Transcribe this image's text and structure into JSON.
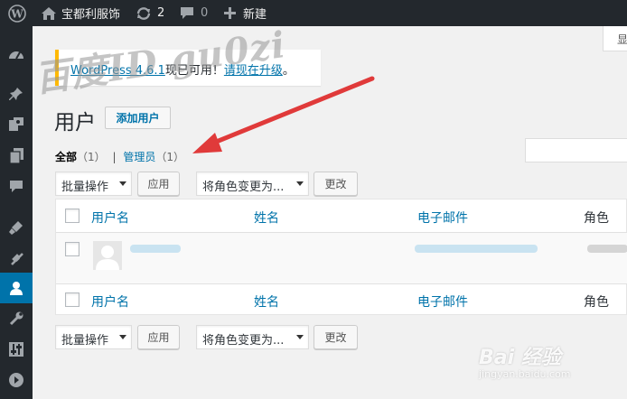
{
  "admin_bar": {
    "site_name": "宝都利服饰",
    "updates_count": "2",
    "comments_count": "0",
    "new_label": "新建"
  },
  "screen_options_label": "显",
  "notice": {
    "link_text": "WordPress 4.6.1",
    "middle_text": "现已可用！",
    "action_text": "请现在升级",
    "end_text": "。"
  },
  "page": {
    "title": "用户",
    "add_new_label": "添加用户"
  },
  "filters": {
    "all_label": "全部",
    "all_count": "（1）",
    "separator": "|",
    "admin_label": "管理员",
    "admin_count": "（1）"
  },
  "bulk_actions": {
    "select_label": "批量操作",
    "apply_label": "应用",
    "role_select_label": "将角色变更为...",
    "change_label": "更改"
  },
  "table": {
    "columns": [
      "用户名",
      "姓名",
      "电子邮件",
      "角色"
    ]
  },
  "watermark": {
    "author_text": "百度ID gu0zi",
    "baidu_text": "Bai 经验",
    "baidu_url": "jingyan.baidu.com"
  },
  "colors": {
    "admin_bar_bg": "#23282d",
    "accent_blue": "#0073aa",
    "notice_border": "#ffb900",
    "arrow_red": "#e03a3a"
  }
}
